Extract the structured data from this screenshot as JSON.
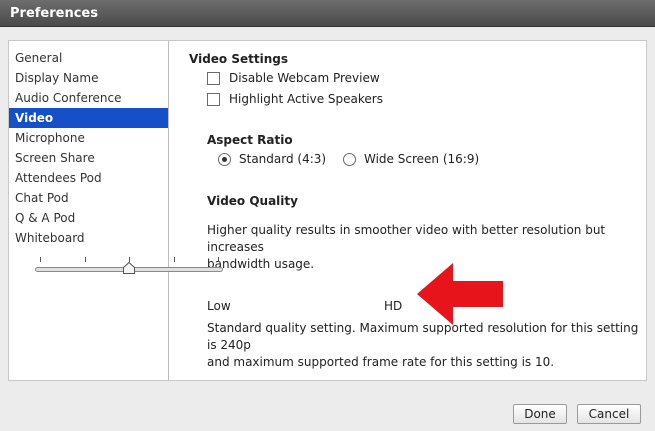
{
  "window": {
    "title": "Preferences"
  },
  "sidebar": {
    "items": [
      {
        "label": "General"
      },
      {
        "label": "Display Name"
      },
      {
        "label": "Audio Conference"
      },
      {
        "label": "Video",
        "selected": true
      },
      {
        "label": "Microphone"
      },
      {
        "label": "Screen Share"
      },
      {
        "label": "Attendees Pod"
      },
      {
        "label": "Chat Pod"
      },
      {
        "label": "Q & A Pod"
      },
      {
        "label": "Whiteboard"
      }
    ]
  },
  "video_settings": {
    "title": "Video Settings",
    "disable_webcam_preview": {
      "label": "Disable Webcam Preview",
      "checked": false
    },
    "highlight_active_speakers": {
      "label": "Highlight Active Speakers",
      "checked": false
    }
  },
  "aspect_ratio": {
    "title": "Aspect Ratio",
    "options": [
      {
        "label": "Standard (4:3)",
        "selected": true
      },
      {
        "label": "Wide Screen (16:9)",
        "selected": false
      }
    ]
  },
  "video_quality": {
    "title": "Video Quality",
    "description_line1": "Higher quality results in smoother video with better resolution but increases",
    "description_line2": "bandwidth usage.",
    "slider": {
      "min_label": "Low",
      "max_label": "HD",
      "steps": 5,
      "value_index": 2
    },
    "info_line1": "Standard quality setting. Maximum supported resolution for this setting is 240p",
    "info_line2": "and maximum supported frame rate for this setting is 10."
  },
  "annotation": {
    "arrow_color": "#e8141c"
  },
  "buttons": {
    "done": "Done",
    "cancel": "Cancel"
  },
  "colors": {
    "selection": "#1550c8"
  }
}
